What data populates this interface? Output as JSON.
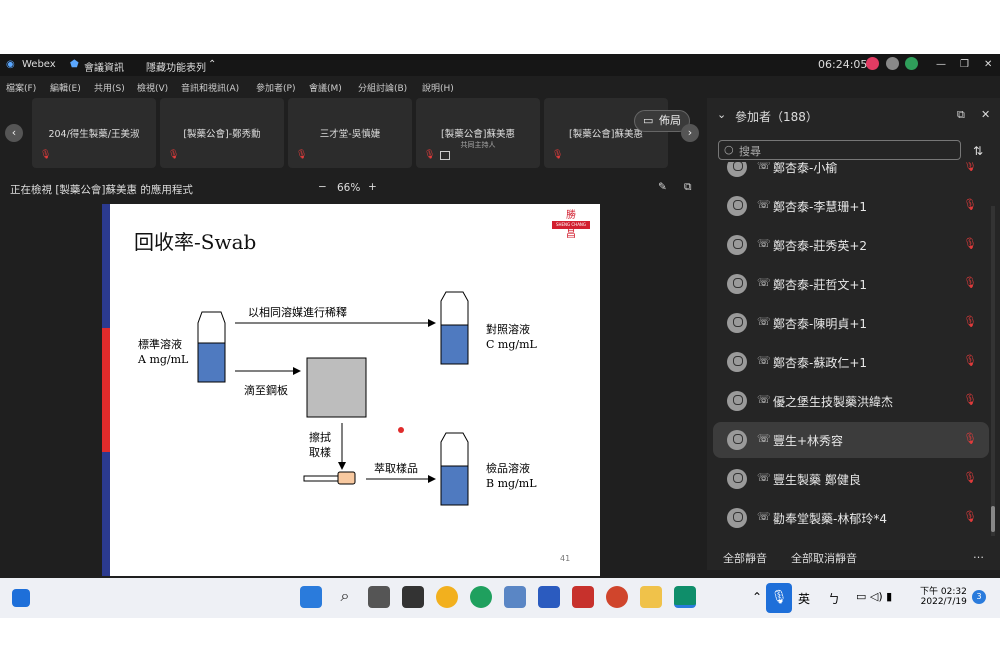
{
  "titlebar": {
    "app": "Webex",
    "meeting_info": "會議資訊",
    "hidden_menu": "隱藏功能表列",
    "time": "06:24:05"
  },
  "menubar": [
    "檔案(F)",
    "編輯(E)",
    "共用(S)",
    "檢視(V)",
    "音訊和視訊(A)",
    "參加者(P)",
    "會議(M)",
    "分組討論(B)",
    "說明(H)"
  ],
  "tiles": [
    {
      "name": "204/得生製藥/王美淑",
      "sub": ""
    },
    {
      "name": "[製藥公會]-鄭秀勳",
      "sub": ""
    },
    {
      "name": "三才堂-吳慎婕",
      "sub": ""
    },
    {
      "name": "[製藥公會]蘇美惠",
      "sub": "共同主持人"
    },
    {
      "name": "[製藥公會]蘇美惠",
      "sub": ""
    }
  ],
  "layout_label": "佈局",
  "viewing": "正在檢視 [製藥公會]蘇美惠 的應用程式",
  "zoom": "66%",
  "slide": {
    "title": "回收率-Swab",
    "std": "標準溶液",
    "std_conc": "A mg/mL",
    "dilute": "以相同溶媒進行稀釋",
    "ref": "對照溶液",
    "ref_conc": "C mg/mL",
    "drop": "滴至鋼板",
    "wipe1": "擦拭",
    "wipe2": "取樣",
    "extract": "萃取樣品",
    "sample": "檢品溶液",
    "sample_conc": "B mg/mL",
    "page": "41",
    "logo_top": "勝",
    "logo_mid": "SHENG CHANG",
    "logo_bot": "昌"
  },
  "participants": {
    "header": "參加者（188）",
    "search": "搜尋",
    "mute_all": "全部靜音",
    "unmute_all": "全部取消靜音",
    "rows": [
      "鄭杏泰-小榆",
      "鄭杏泰-李慧珊+1",
      "鄭杏泰-莊秀英+2",
      "鄭杏泰-莊哲文+1",
      "鄭杏泰-陳明貞+1",
      "鄭杏泰-蘇政仁+1",
      "優之堡生技製藥洪緯杰",
      "豐生+林秀容",
      "豐生製藥 鄭健良",
      "勸奉堂製藥-林郁玲*4"
    ]
  },
  "taskbar": {
    "lang": "英",
    "ime": "ㄅ",
    "time": "下午 02:32",
    "date": "2022/7/19",
    "badge": "3"
  }
}
